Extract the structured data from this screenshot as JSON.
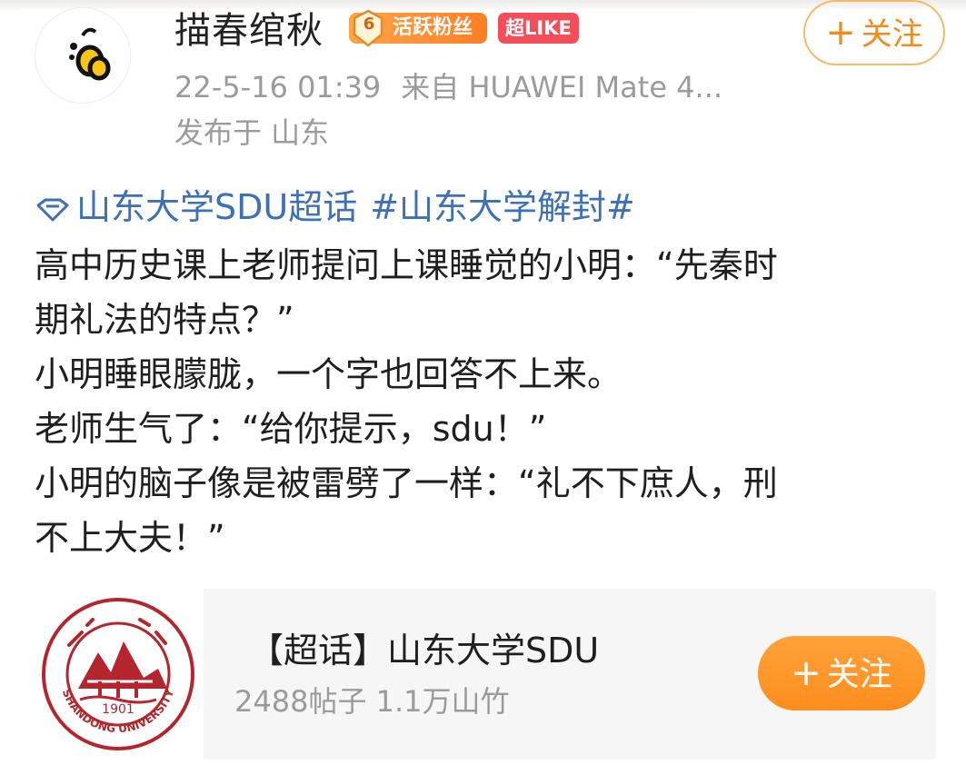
{
  "post": {
    "author": {
      "name": "描春绾秋",
      "fan_badge_level": "6",
      "fan_badge_label": "活跃粉丝",
      "vip_badge": "超LIKE"
    },
    "follow_label": "关注",
    "follow_plus": "+",
    "timestamp": "22-5-16 01:39",
    "source": "来自 HUAWEI Mate 4...",
    "location": "发布于 山东",
    "topic": "山东大学SDU超话",
    "hashtag": "#山东大学解封#",
    "body_lines": [
      "高中历史课上老师提问上课睡觉的小明：“先秦时",
      "期礼法的特点？”",
      "小明睡眼朦胧，一个字也回答不上来。",
      "老师生气了：“给你提示，sdu！”",
      "小明的脑子像是被雷劈了一样：“礼不下庶人，刑",
      "不上大夫！”"
    ]
  },
  "super_topic_card": {
    "title": "【超话】山东大学SDU",
    "stats": "2488帖子 1.1万山竹",
    "follow_label": "关注",
    "follow_plus": "+",
    "logo_year": "1901",
    "logo_text": "SHANDONG UNIVERSITY"
  },
  "colors": {
    "accent_orange": "#ff8d1e",
    "link_blue": "#3e70b5",
    "vip_red": "#f34e59",
    "logo_red": "#b3262d"
  },
  "icons": {
    "avatar": "bee-avatar-icon",
    "topic": "diamond-icon",
    "fan_level": "fan-level-badge-icon",
    "logo": "shandong-university-logo"
  }
}
